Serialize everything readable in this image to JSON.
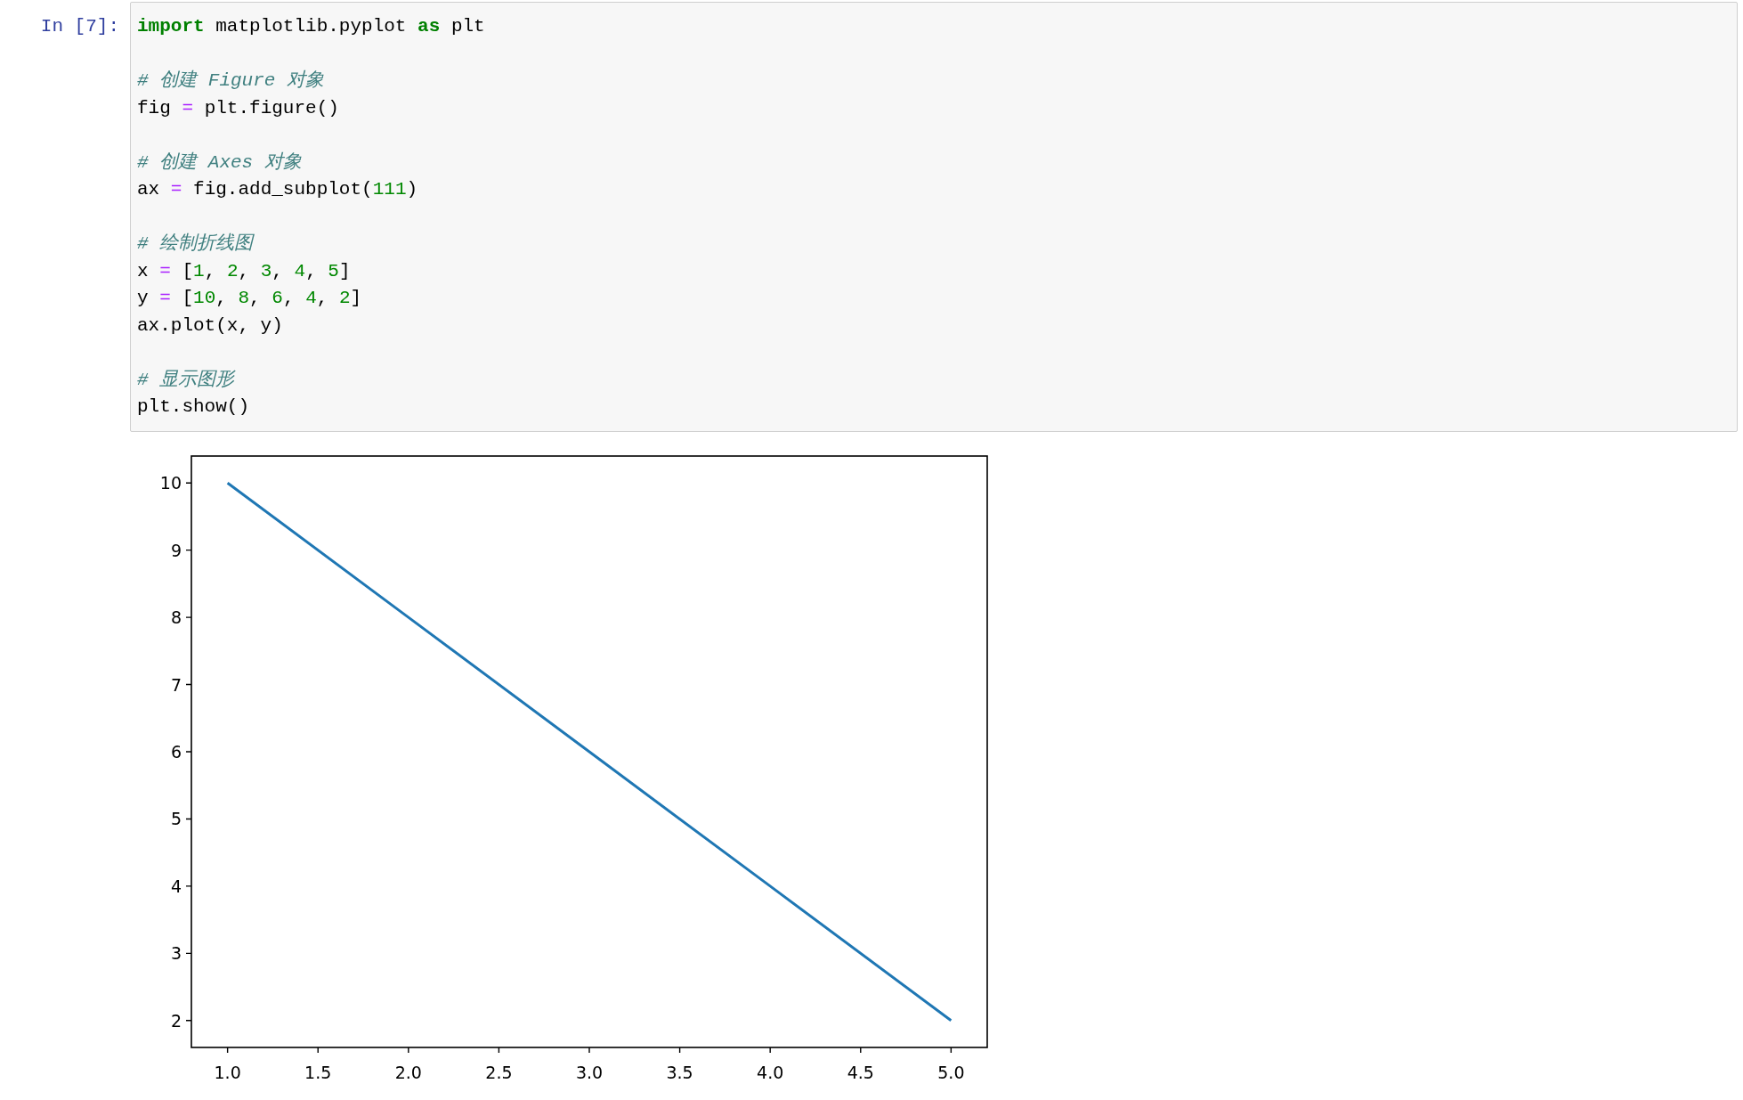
{
  "cell": {
    "prompt": "In [7]:",
    "code_blocks": [
      {
        "lines": [
          {
            "tokens": [
              {
                "kind": "keyword",
                "text": "import"
              },
              {
                "kind": "plain",
                "text": " matplotlib.pyplot "
              },
              {
                "kind": "keyword",
                "text": "as"
              },
              {
                "kind": "plain",
                "text": " plt"
              }
            ]
          }
        ]
      },
      {
        "lines": [
          {
            "tokens": [
              {
                "kind": "comment",
                "text": "# 创建 Figure 对象"
              }
            ]
          },
          {
            "tokens": [
              {
                "kind": "plain",
                "text": "fig "
              },
              {
                "kind": "operator",
                "text": "="
              },
              {
                "kind": "plain",
                "text": " plt.figure()"
              }
            ]
          }
        ]
      },
      {
        "lines": [
          {
            "tokens": [
              {
                "kind": "comment",
                "text": "# 创建 Axes 对象"
              }
            ]
          },
          {
            "tokens": [
              {
                "kind": "plain",
                "text": "ax "
              },
              {
                "kind": "operator",
                "text": "="
              },
              {
                "kind": "plain",
                "text": " fig.add_subplot("
              },
              {
                "kind": "number",
                "text": "111"
              },
              {
                "kind": "plain",
                "text": ")"
              }
            ]
          }
        ]
      },
      {
        "lines": [
          {
            "tokens": [
              {
                "kind": "comment",
                "text": "# 绘制折线图"
              }
            ]
          },
          {
            "tokens": [
              {
                "kind": "plain",
                "text": "x "
              },
              {
                "kind": "operator",
                "text": "="
              },
              {
                "kind": "plain",
                "text": " ["
              },
              {
                "kind": "number",
                "text": "1"
              },
              {
                "kind": "plain",
                "text": ", "
              },
              {
                "kind": "number",
                "text": "2"
              },
              {
                "kind": "plain",
                "text": ", "
              },
              {
                "kind": "number",
                "text": "3"
              },
              {
                "kind": "plain",
                "text": ", "
              },
              {
                "kind": "number",
                "text": "4"
              },
              {
                "kind": "plain",
                "text": ", "
              },
              {
                "kind": "number",
                "text": "5"
              },
              {
                "kind": "plain",
                "text": "]"
              }
            ]
          },
          {
            "tokens": [
              {
                "kind": "plain",
                "text": "y "
              },
              {
                "kind": "operator",
                "text": "="
              },
              {
                "kind": "plain",
                "text": " ["
              },
              {
                "kind": "number",
                "text": "10"
              },
              {
                "kind": "plain",
                "text": ", "
              },
              {
                "kind": "number",
                "text": "8"
              },
              {
                "kind": "plain",
                "text": ", "
              },
              {
                "kind": "number",
                "text": "6"
              },
              {
                "kind": "plain",
                "text": ", "
              },
              {
                "kind": "number",
                "text": "4"
              },
              {
                "kind": "plain",
                "text": ", "
              },
              {
                "kind": "number",
                "text": "2"
              },
              {
                "kind": "plain",
                "text": "]"
              }
            ]
          },
          {
            "tokens": [
              {
                "kind": "plain",
                "text": "ax.plot(x, y)"
              }
            ]
          }
        ]
      },
      {
        "lines": [
          {
            "tokens": [
              {
                "kind": "comment",
                "text": "# 显示图形"
              }
            ]
          },
          {
            "tokens": [
              {
                "kind": "plain",
                "text": "plt.show()"
              }
            ]
          }
        ]
      }
    ]
  },
  "output": {
    "chart_data": {
      "type": "line",
      "x": [
        1,
        2,
        3,
        4,
        5
      ],
      "series": [
        {
          "color": "#1f77b4",
          "values": [
            10,
            8,
            6,
            4,
            2
          ]
        }
      ],
      "xlim": [
        0.8,
        5.2
      ],
      "ylim": [
        1.6,
        10.4
      ],
      "xticks": [
        {
          "value": 1,
          "label": "1.0"
        },
        {
          "value": 1.5,
          "label": "1.5"
        },
        {
          "value": 2,
          "label": "2.0"
        },
        {
          "value": 2.5,
          "label": "2.5"
        },
        {
          "value": 3,
          "label": "3.0"
        },
        {
          "value": 3.5,
          "label": "3.5"
        },
        {
          "value": 4,
          "label": "4.0"
        },
        {
          "value": 4.5,
          "label": "4.5"
        },
        {
          "value": 5,
          "label": "5.0"
        }
      ],
      "yticks": [
        2,
        3,
        4,
        5,
        6,
        7,
        8,
        9,
        10
      ]
    }
  }
}
